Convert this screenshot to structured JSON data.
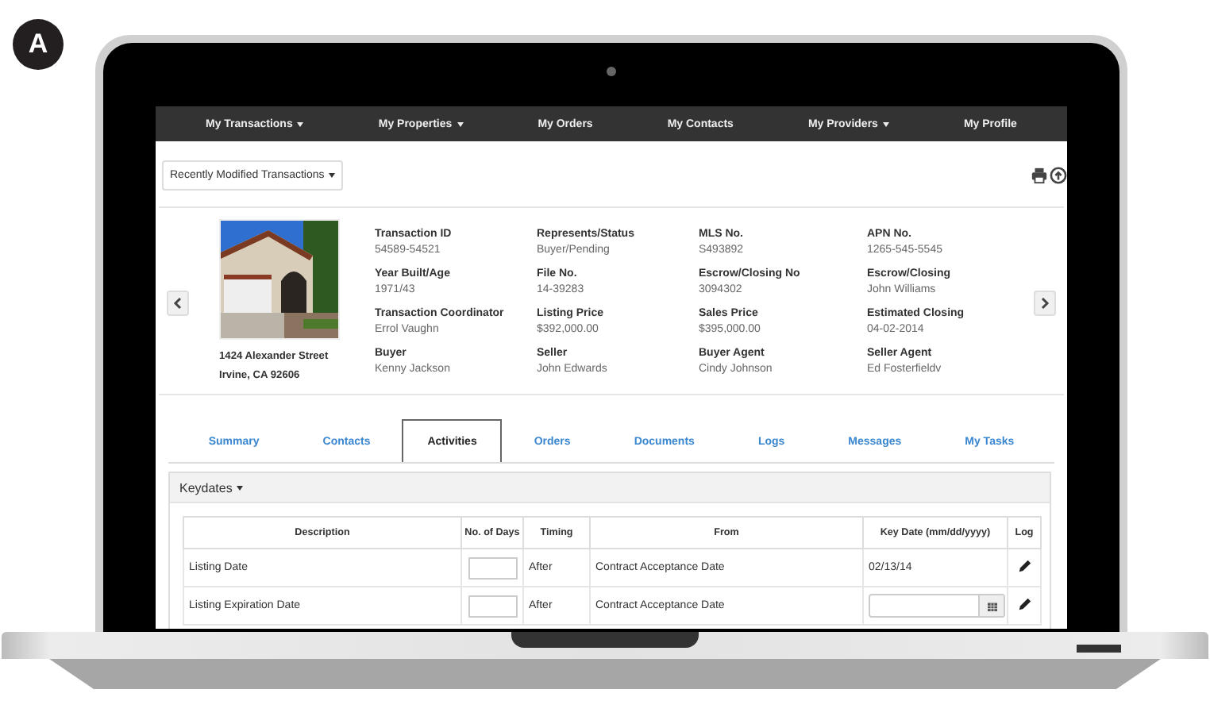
{
  "badge": "A",
  "nav": [
    {
      "label": "My Transactions",
      "dropdown": true
    },
    {
      "label": "My Properties",
      "dropdown": true
    },
    {
      "label": "My Orders",
      "dropdown": false
    },
    {
      "label": "My Contacts",
      "dropdown": false
    },
    {
      "label": "My Providers",
      "dropdown": true
    },
    {
      "label": "My Profile",
      "dropdown": false
    }
  ],
  "view_select": "Recently Modified Transactions",
  "property": {
    "address": [
      "1424 Alexander Street",
      "Irvine, CA 92606"
    ]
  },
  "fields": [
    {
      "label": "Transaction ID",
      "value": "54589-54521"
    },
    {
      "label": "Represents/Status",
      "value": "Buyer/Pending"
    },
    {
      "label": "MLS No.",
      "value": "S493892"
    },
    {
      "label": "APN No.",
      "value": "1265-545-5545"
    },
    {
      "label": "Year Built/Age",
      "value": "1971/43"
    },
    {
      "label": "File No.",
      "value": "14-39283"
    },
    {
      "label": "Escrow/Closing No",
      "value": "3094302"
    },
    {
      "label": "Escrow/Closing",
      "value": "John Williams"
    },
    {
      "label": "Transaction Coordinator",
      "value": "Errol Vaughn"
    },
    {
      "label": "Listing Price",
      "value": "$392,000.00"
    },
    {
      "label": "Sales Price",
      "value": "$395,000.00"
    },
    {
      "label": "Estimated Closing",
      "value": "04-02-2014"
    },
    {
      "label": "Buyer",
      "value": "Kenny Jackson"
    },
    {
      "label": "Seller",
      "value": "John Edwards"
    },
    {
      "label": "Buyer Agent",
      "value": "Cindy Johnson"
    },
    {
      "label": "Seller Agent",
      "value": "Ed Fosterfieldv"
    }
  ],
  "tabs": [
    {
      "label": "Summary",
      "selected": false
    },
    {
      "label": "Contacts",
      "selected": false
    },
    {
      "label": "Activities",
      "selected": true
    },
    {
      "label": "Orders",
      "selected": false
    },
    {
      "label": "Documents",
      "selected": false
    },
    {
      "label": "Logs",
      "selected": false
    },
    {
      "label": "Messages",
      "selected": false
    },
    {
      "label": "My Tasks",
      "selected": false
    }
  ],
  "keydates": {
    "title": "Keydates",
    "columns": [
      "Description",
      "No. of Days",
      "Timing",
      "From",
      "Key Date (mm/dd/yyyy)",
      "Log"
    ],
    "rows": [
      {
        "description": "Listing Date",
        "timing": "After",
        "from": "Contract Acceptance Date",
        "key_date": {
          "kind": "text",
          "value": "02/13/14"
        }
      },
      {
        "description": "Listing Expiration Date",
        "timing": "After",
        "from": "Contract Acceptance Date",
        "key_date": {
          "kind": "date_input"
        }
      }
    ]
  }
}
